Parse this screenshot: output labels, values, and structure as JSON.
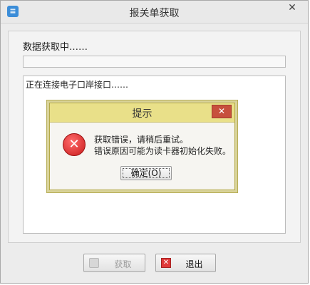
{
  "window": {
    "title": "报关单获取",
    "close_glyph": "✕",
    "icon": "app-icon"
  },
  "main": {
    "status_text": "数据获取中……",
    "progress": 0,
    "log_line": "正在连接电子口岸接口……"
  },
  "buttons": {
    "fetch_label": "获取",
    "exit_label": "退出",
    "exit_icon_glyph": "✕"
  },
  "dialog": {
    "title": "提示",
    "close_glyph": "✕",
    "error_icon_glyph": "✕",
    "line1": "获取错误，请稍后重试。",
    "line2": "错误原因可能为读卡器初始化失败。",
    "ok_label": "确定(O)"
  },
  "colors": {
    "dialog_title_bg": "#e9e089",
    "dialog_close_bg": "#c7503d",
    "error_red": "#c91b1b"
  }
}
